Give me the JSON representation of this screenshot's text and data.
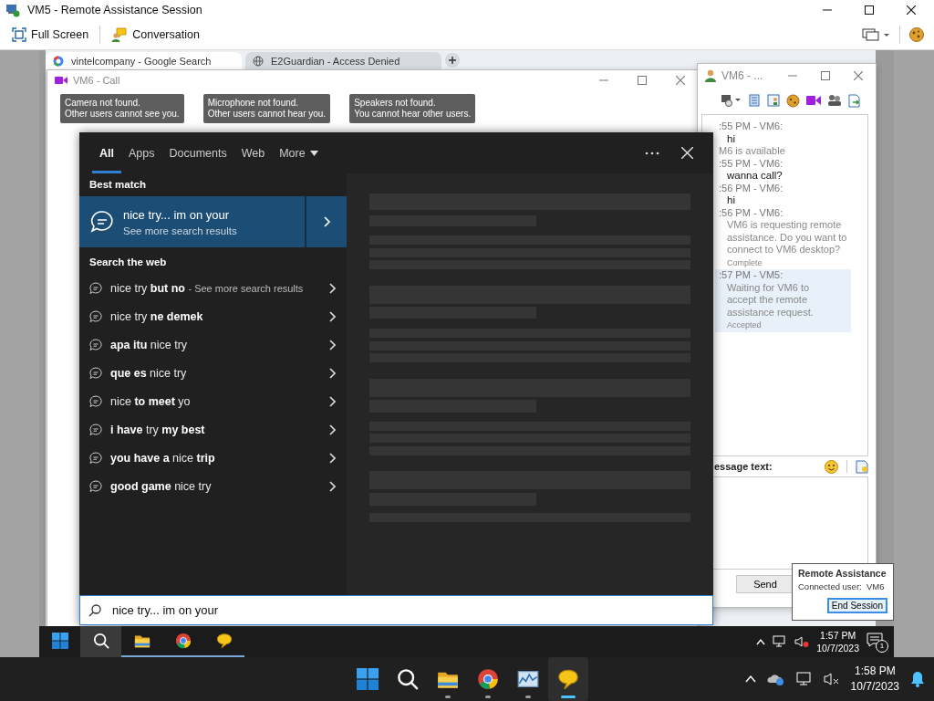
{
  "window": {
    "title": "VM5 - Remote Assistance Session"
  },
  "toolbar": {
    "full_screen": "Full Screen",
    "conversation": "Conversation"
  },
  "browser": {
    "tabs": [
      {
        "title": "vintelcompany - Google Search",
        "selected": true
      },
      {
        "title": "E2Guardian - Access Denied",
        "selected": false
      }
    ]
  },
  "call_window": {
    "title": "VM6 - Call",
    "notices": [
      {
        "title": "Camera not found.",
        "detail": "Other users cannot see you."
      },
      {
        "title": "Microphone not found.",
        "detail": "Other users cannot hear you."
      },
      {
        "title": "Speakers not found.",
        "detail": "You cannot hear other users."
      }
    ]
  },
  "chat_window": {
    "title": "VM6 - ...",
    "messages": [
      {
        "kind": "message",
        "header": ":55 PM - VM6:",
        "text": "hi",
        "highlighted": false
      },
      {
        "kind": "status",
        "text": "M6 is available",
        "highlighted": false
      },
      {
        "kind": "message",
        "header": ":55 PM - VM6:",
        "text": "wanna call?",
        "highlighted": false
      },
      {
        "kind": "message",
        "header": ":56 PM - VM6:",
        "text": "hi",
        "highlighted": false
      },
      {
        "kind": "system",
        "header": ":56 PM - VM6:",
        "text": "VM6 is requesting remote assistance. Do you want to connect to VM6 desktop?",
        "note": "Complete",
        "highlighted": false
      },
      {
        "kind": "system",
        "header": ":57 PM - VM5:",
        "text": "Waiting for VM6 to accept the remote assistance request.",
        "note": "Accepted",
        "highlighted": true
      }
    ],
    "message_label": "essage text:",
    "send": "Send"
  },
  "search": {
    "tabs": [
      {
        "label": "All",
        "selected": true
      },
      {
        "label": "Apps",
        "selected": false
      },
      {
        "label": "Documents",
        "selected": false
      },
      {
        "label": "Web",
        "selected": false
      },
      {
        "label": "More",
        "selected": false,
        "kind": "dropdown"
      }
    ],
    "best_match_heading": "Best match",
    "best_match": {
      "title": "nice try... im on your",
      "subtitle": "See more search results"
    },
    "web_heading": "Search the web",
    "suggestions": [
      {
        "text": "nice try **but no**",
        "note": "- See more search results"
      },
      {
        "text": "nice try **ne demek**"
      },
      {
        "text": "**apa itu** nice try"
      },
      {
        "text": "**que es** nice try"
      },
      {
        "text": "nice **to meet** yo"
      },
      {
        "text": "**i have** try **my best**"
      },
      {
        "text": "**you have a** nice **trip**"
      },
      {
        "text": "**good game** nice try"
      }
    ],
    "query": "nice try... im on your"
  },
  "taskbar": {
    "apps": [
      {
        "kind": "start",
        "active": false,
        "running": false
      },
      {
        "kind": "search",
        "active": true,
        "running": false
      },
      {
        "kind": "folder",
        "active": false,
        "running": true
      },
      {
        "kind": "browser",
        "active": false,
        "running": true
      },
      {
        "kind": "chat",
        "active": false,
        "running": true
      }
    ],
    "time": "1:57 PM",
    "date": "10/7/2023",
    "notifications": "1"
  },
  "remote_assistance_popup": {
    "title": "Remote Assistance",
    "status": "Connected user:  VM6",
    "button": "End Session"
  },
  "host_taskbar": {
    "apps": [
      {
        "kind": "start",
        "active": false,
        "running": false
      },
      {
        "kind": "search",
        "active": false,
        "running": false
      },
      {
        "kind": "folder",
        "active": false,
        "running": true
      },
      {
        "kind": "browser",
        "active": false,
        "running": true
      },
      {
        "kind": "chart",
        "active": false,
        "running": true
      },
      {
        "kind": "chat",
        "active": true,
        "running": true
      }
    ],
    "time": "1:58 PM",
    "date": "10/7/2023"
  }
}
